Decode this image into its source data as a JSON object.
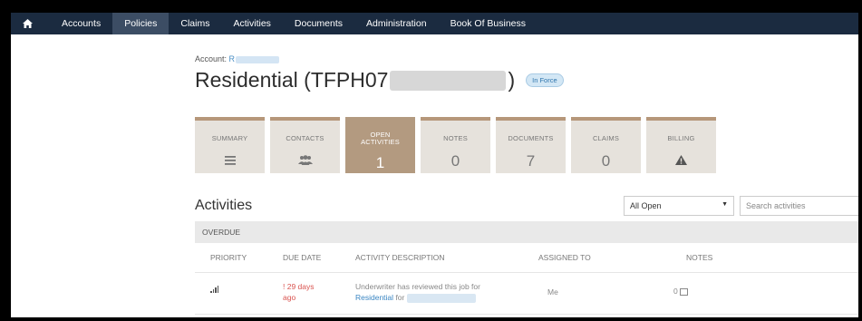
{
  "nav": {
    "items": [
      {
        "label": "Accounts",
        "active": false
      },
      {
        "label": "Policies",
        "active": true
      },
      {
        "label": "Claims",
        "active": false
      },
      {
        "label": "Activities",
        "active": false
      },
      {
        "label": "Documents",
        "active": false
      },
      {
        "label": "Administration",
        "active": false
      },
      {
        "label": "Book Of Business",
        "active": false
      }
    ]
  },
  "account": {
    "label": "Account:",
    "name": "R"
  },
  "policy": {
    "title_prefix": "Residential (TFPH07",
    "title_suffix": ")",
    "status": "In Force"
  },
  "tiles": [
    {
      "label": "SUMMARY",
      "icon": "list-icon",
      "value": ""
    },
    {
      "label": "CONTACTS",
      "icon": "users-icon",
      "value": ""
    },
    {
      "label_line1": "OPEN",
      "label_line2": "ACTIVITIES",
      "value": "1",
      "active": true
    },
    {
      "label": "NOTES",
      "value": "0"
    },
    {
      "label": "DOCUMENTS",
      "value": "7"
    },
    {
      "label": "CLAIMS",
      "value": "0"
    },
    {
      "label": "BILLING",
      "icon": "warning-icon",
      "value": ""
    }
  ],
  "activities": {
    "title": "Activities",
    "filter": {
      "selected": "All Open"
    },
    "search": {
      "placeholder": "Search activities"
    },
    "group": "OVERDUE",
    "columns": [
      "PRIORITY",
      "DUE DATE",
      "ACTIVITY DESCRIPTION",
      "ASSIGNED TO",
      "NOTES"
    ],
    "rows": [
      {
        "due_line1": "! 29 days",
        "due_line2": "ago",
        "desc_text": "Underwriter has reviewed this job for",
        "desc_link": "Residential",
        "desc_for": "for",
        "assigned": "Me",
        "notes": "0"
      }
    ]
  },
  "colors": {
    "nav_bg": "#1b2b40",
    "tile_active": "#b39a80",
    "overdue": "#d9534f",
    "link": "#3a86c3"
  }
}
